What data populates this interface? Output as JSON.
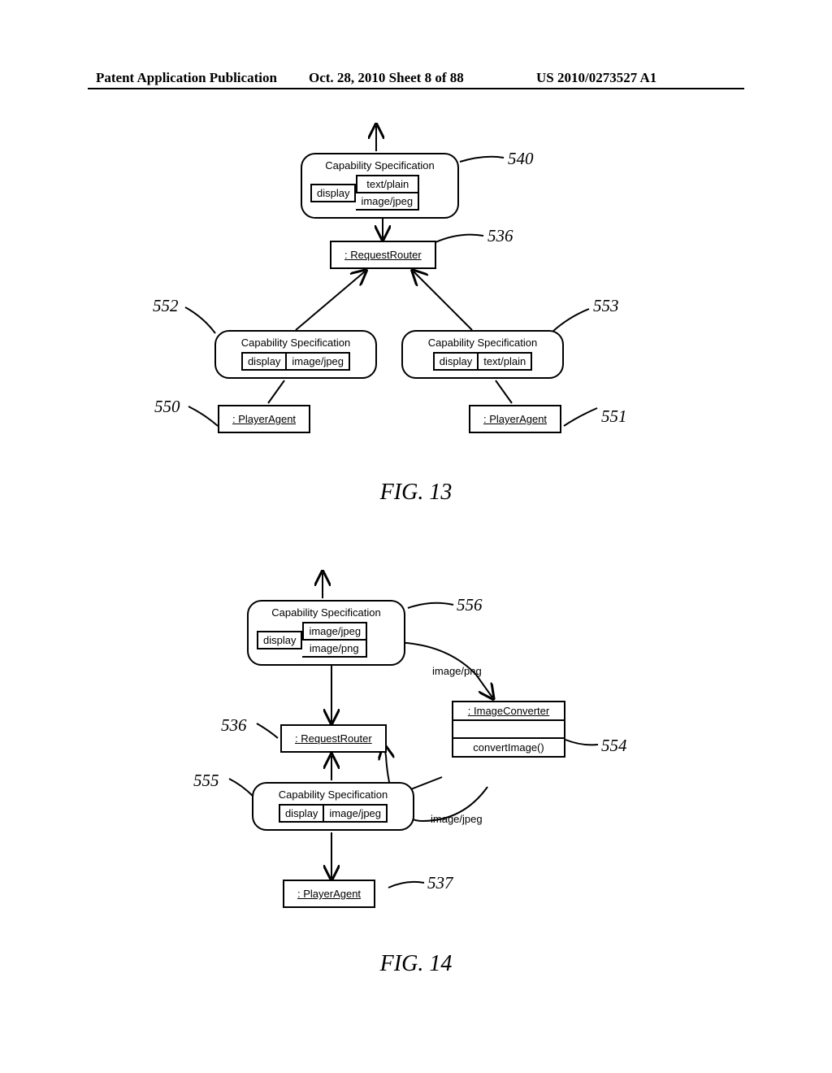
{
  "header": {
    "left": "Patent Application Publication",
    "center": "Oct. 28, 2010  Sheet 8 of 88",
    "right": "US 2010/0273527 A1"
  },
  "fig13": {
    "title": "FIG. 13",
    "cap540": {
      "title": "Capability Specification",
      "k": "display",
      "v1": "text/plain",
      "v2": "image/jpeg",
      "ref": "540"
    },
    "router": {
      "label": ": RequestRouter",
      "ref": "536"
    },
    "cap552": {
      "title": "Capability Specification",
      "k": "display",
      "v": "image/jpeg",
      "ref": "552"
    },
    "cap553": {
      "title": "Capability Specification",
      "k": "display",
      "v": "text/plain",
      "ref": "553"
    },
    "agent550": {
      "label": ": PlayerAgent",
      "ref": "550"
    },
    "agent551": {
      "label": ": PlayerAgent",
      "ref": "551"
    }
  },
  "fig14": {
    "title": "FIG. 14",
    "cap556": {
      "title": "Capability Specification",
      "k": "display",
      "v1": "image/jpeg",
      "v2": "image/png",
      "ref": "556"
    },
    "router": {
      "label": ": RequestRouter",
      "ref": "536"
    },
    "imgconv": {
      "label": ": ImageConverter",
      "method": "convertImage()",
      "ref": "554"
    },
    "cap555": {
      "title": "Capability Specification",
      "k": "display",
      "v": "image/jpeg",
      "ref": "555"
    },
    "agent537": {
      "label": ": PlayerAgent",
      "ref": "537"
    },
    "label_png": "image/png",
    "label_jpeg": "image/jpeg"
  }
}
